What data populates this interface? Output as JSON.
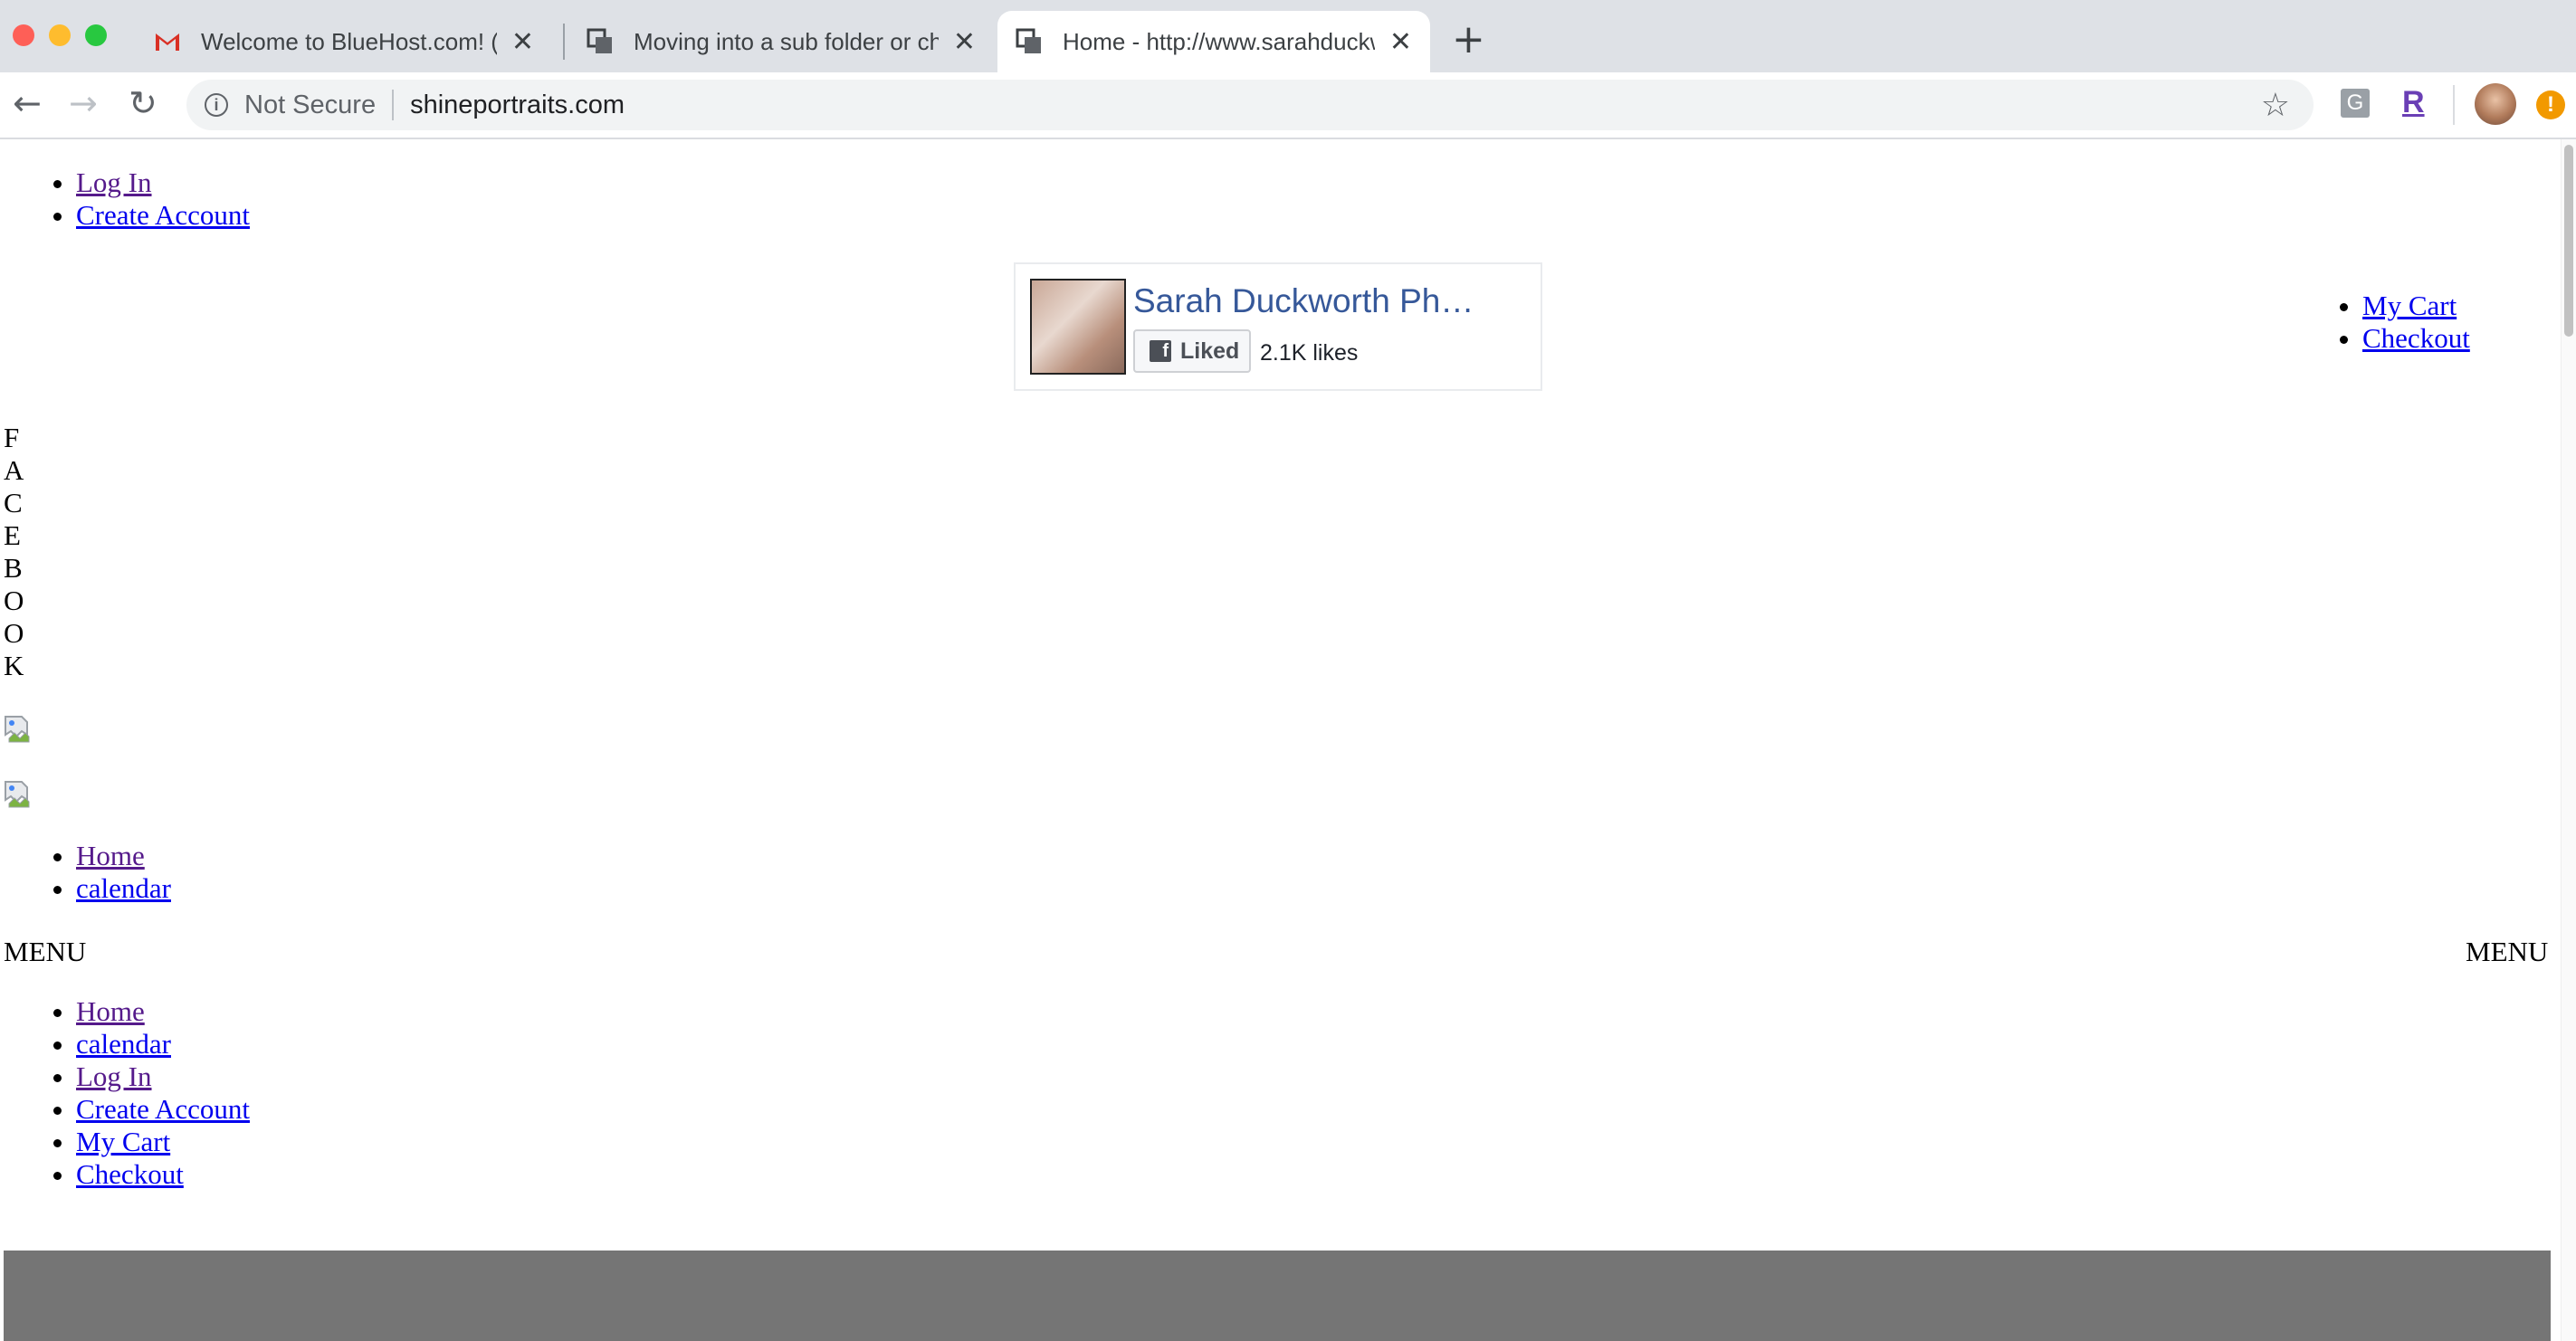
{
  "browser": {
    "tabs": [
      {
        "title": "Welcome to BlueHost.com! (sa",
        "icon": "gmail-icon",
        "active": false
      },
      {
        "title": "Moving into a sub folder or cha",
        "icon": "page-icon",
        "active": false
      },
      {
        "title": "Home - http://www.sarahduckw",
        "icon": "page-icon",
        "active": true
      }
    ],
    "security_label": "Not Secure",
    "url": "shineportraits.com",
    "extensions": [
      "G",
      "R"
    ]
  },
  "account_links": {
    "login": "Log In",
    "create": "Create Account"
  },
  "cart_links": {
    "cart": "My Cart",
    "checkout": "Checkout"
  },
  "fb_widget": {
    "page_name": "Sarah Duckworth Ph…",
    "liked_label": "Liked",
    "likes_count": "2.1K likes"
  },
  "vertical_text": [
    "F",
    "A",
    "C",
    "E",
    "B",
    "O",
    "O",
    "K"
  ],
  "nav_primary": {
    "home": "Home",
    "calendar": "calendar"
  },
  "menu_label_left": "MENU",
  "menu_label_right": "MENU",
  "nav_full": {
    "home": "Home",
    "calendar": "calendar",
    "login": "Log In",
    "create": "Create Account",
    "cart": "My Cart",
    "checkout": "Checkout"
  },
  "colors": {
    "link": "#0000ee",
    "visited_link": "#551a8b",
    "fb_blue": "#365899",
    "footer_band": "#757575"
  }
}
